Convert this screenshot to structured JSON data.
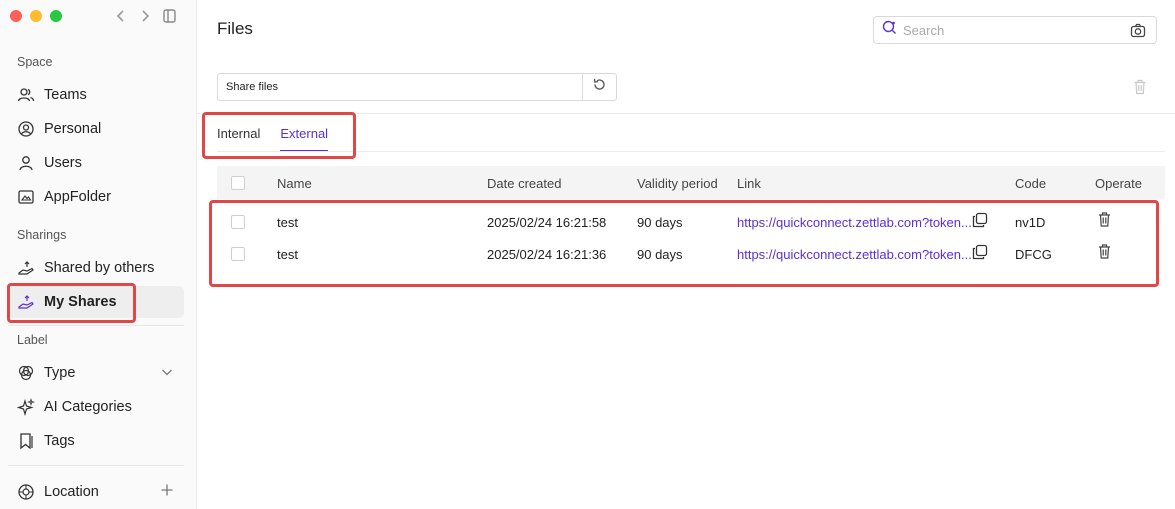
{
  "sidebar": {
    "sections": {
      "space": "Space",
      "sharings": "Sharings",
      "label": "Label"
    },
    "space_items": [
      {
        "label": "Teams",
        "icon": "people-icon"
      },
      {
        "label": "Personal",
        "icon": "user-circle-icon"
      },
      {
        "label": "Users",
        "icon": "user-icon"
      },
      {
        "label": "AppFolder",
        "icon": "app-folder-icon"
      }
    ],
    "sharing_items": [
      {
        "label": "Shared by others",
        "icon": "share-hand-icon"
      },
      {
        "label": "My Shares",
        "icon": "share-hand-icon",
        "active": true
      }
    ],
    "label_items": [
      {
        "label": "Type",
        "icon": "type-icon"
      },
      {
        "label": "AI Categories",
        "icon": "sparkle-icon"
      },
      {
        "label": "Tags",
        "icon": "tag-icon"
      }
    ],
    "location": {
      "label": "Location",
      "icon": "location-icon"
    }
  },
  "main": {
    "title": "Files",
    "search": {
      "placeholder": "Search"
    },
    "share_input": "Share files",
    "tabs": [
      {
        "label": "Internal",
        "active": false
      },
      {
        "label": "External",
        "active": true
      }
    ],
    "table": {
      "headers": {
        "name": "Name",
        "date_created": "Date created",
        "validity": "Validity period",
        "link": "Link",
        "code": "Code",
        "operate": "Operate"
      },
      "rows": [
        {
          "name": "test",
          "date_created": "2025/02/24 16:21:58",
          "validity": "90 days",
          "link": "https://quickconnect.zettlab.com?token...",
          "code": "nv1D"
        },
        {
          "name": "test",
          "date_created": "2025/02/24 16:21:36",
          "validity": "90 days",
          "link": "https://quickconnect.zettlab.com?token...",
          "code": "DFCG"
        }
      ]
    }
  },
  "colors": {
    "accent": "#5b2fd6",
    "highlight": "#e04848"
  }
}
